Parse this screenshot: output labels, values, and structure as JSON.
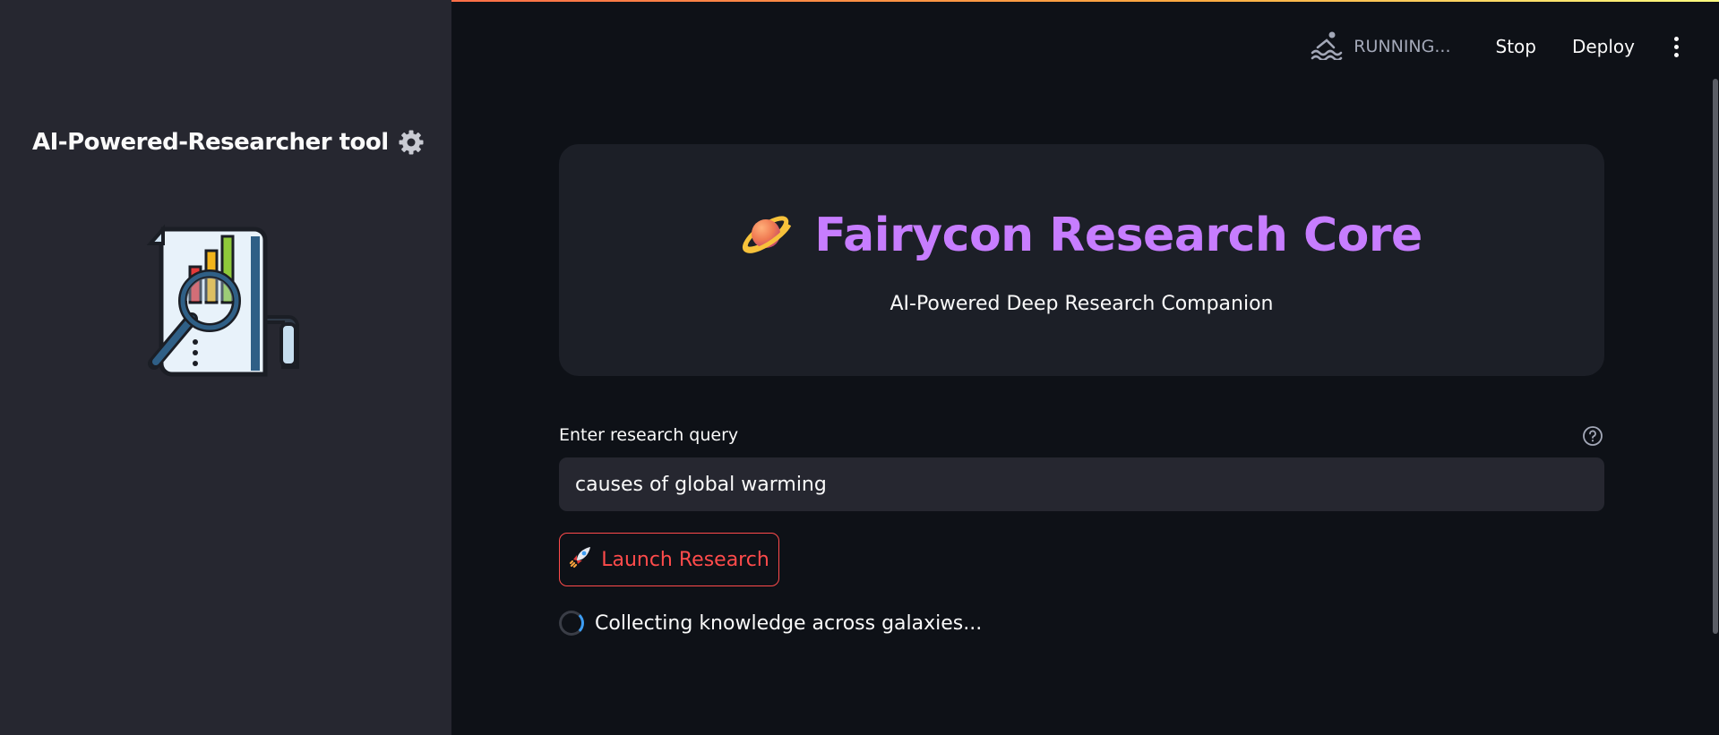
{
  "header": {
    "status_text": "RUNNING...",
    "status_icon": "swimmer-icon",
    "stop_label": "Stop",
    "deploy_label": "Deploy",
    "menu_icon": "kebab-menu-icon"
  },
  "sidebar": {
    "title": "AI-Powered-Researcher tool",
    "title_icon": "gear-icon",
    "logo_icon": "research-report-magnifier-icon"
  },
  "hero": {
    "emoji_icon": "ringed-planet-icon",
    "title": "Fairycon Research Core",
    "subtitle": "AI-Powered Deep Research Companion",
    "title_color": "#c77dff"
  },
  "query": {
    "label": "Enter research query",
    "value": "causes of global warming",
    "help_icon": "question-circle-icon"
  },
  "launch_button": {
    "icon": "rocket-icon",
    "label": "Launch Research",
    "color": "#ff4b4b"
  },
  "status_message": {
    "text": "Collecting knowledge across galaxies...",
    "icon": "spinner-icon"
  }
}
